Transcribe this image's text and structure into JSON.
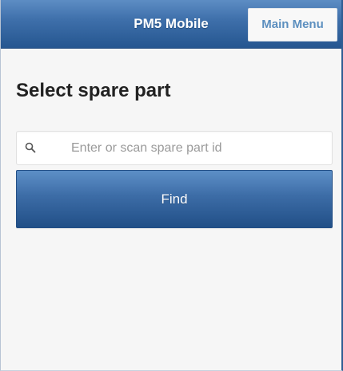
{
  "header": {
    "title": "PM5 Mobile",
    "menu_button_label": "Main Menu"
  },
  "main": {
    "page_title": "Select spare part",
    "search": {
      "placeholder": "Enter or scan spare part id",
      "value": ""
    },
    "find_button_label": "Find"
  },
  "icons": {
    "search": "search-icon"
  },
  "colors": {
    "header_top": "#5d8dc4",
    "header_bottom": "#255690",
    "button_top": "#5d8fc7",
    "button_bottom": "#214f87",
    "menu_button_text": "#5c8fbf",
    "page_background": "#f6f6f6"
  }
}
